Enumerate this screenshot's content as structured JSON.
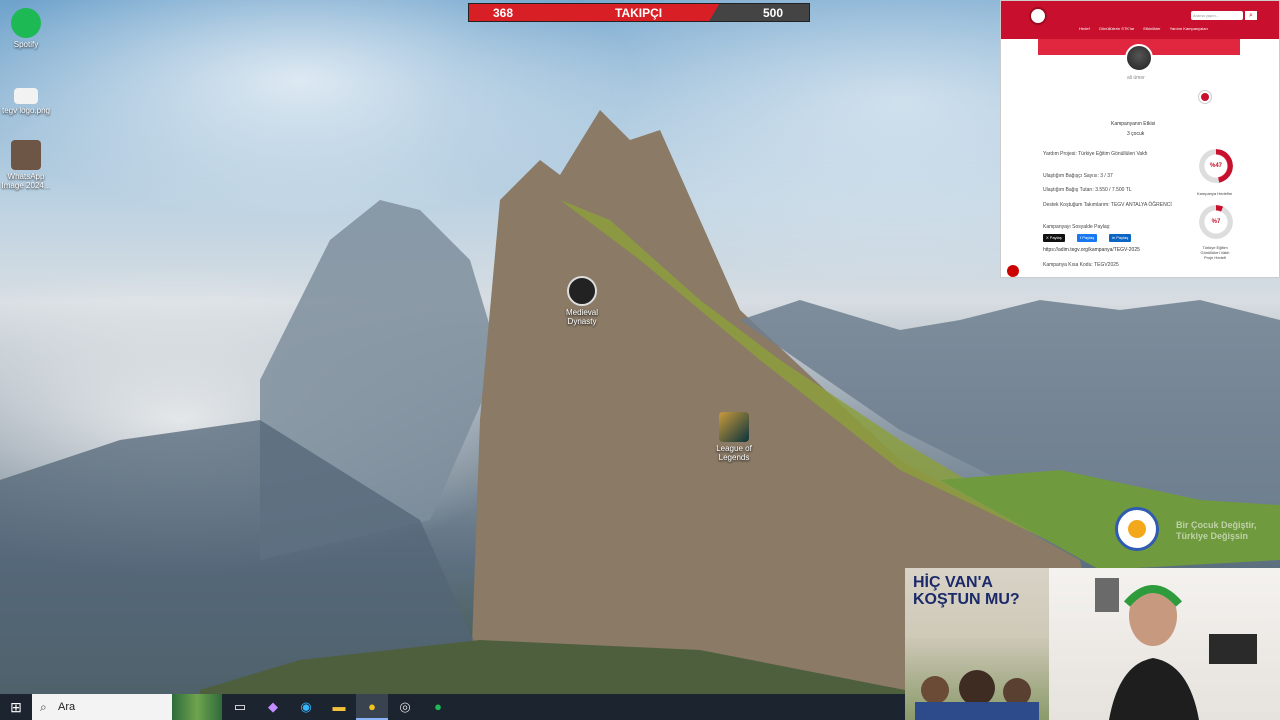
{
  "follower_bar": {
    "current": "368",
    "label": "TAKIPÇI",
    "goal": "500",
    "progress": 0.736
  },
  "desktop_icons": [
    {
      "label": "Spotify"
    },
    {
      "label": "tegv logo.png"
    },
    {
      "label": "WhatsApp Image 2024..."
    },
    {
      "label": "Medieval Dynasty"
    },
    {
      "label": "League of Legends"
    }
  ],
  "browser": {
    "search_placeholder": "Arama yapın...",
    "nav_links": [
      "Hedef",
      "Gönüllülerin STK'lar",
      "Etkinlikler",
      "Yardım Kampanyaları"
    ],
    "username": "ali ümer",
    "impact_title": "Kampanyanın Etkisi",
    "impact_value": "3 çocuk",
    "info_rows": [
      "Yardım Projesi: Türkiye Eğitim Gönüllüleri Vakfı",
      "Ulaştığım Bağışçı Sayısı: 3 / 37",
      "Ulaştığım Bağış Tutarı: 3.550 / 7.500 TL",
      "Destek Koştuğum Takımlarım: TEGV ANTALYA ÖĞRENCİ",
      "Kampanyayı Sosyalde Paylaş:",
      "https://adim.tegv.org/kampanya/TEGV-2025",
      "Kampanya Kısa Kodu: TEGV2025"
    ],
    "share_buttons": [
      "X Paylaş",
      "f Paylaş",
      "in Paylaş"
    ],
    "ring1_value": "%47",
    "ring1_caption": "Kampanya Hedefim",
    "ring2_value": "%7",
    "ring2_caption": "Türkiye Eğitim Gönüllüleri Vakfı Proje Hedefi"
  },
  "badge_text": "Bir Çocuk Değiştir, Türkiye Değişsin",
  "poster": {
    "title": "HİÇ VAN'A\nKOŞTUN MU?"
  },
  "taskbar": {
    "search_label": "Ara",
    "apps": [
      "task-view-icon",
      "copilot-icon",
      "edge-icon",
      "file-explorer-icon",
      "chrome-icon",
      "obs-icon",
      "spotify-icon"
    ]
  },
  "colors": {
    "accent": "#c8102e",
    "taskbar": "#1c2430"
  }
}
